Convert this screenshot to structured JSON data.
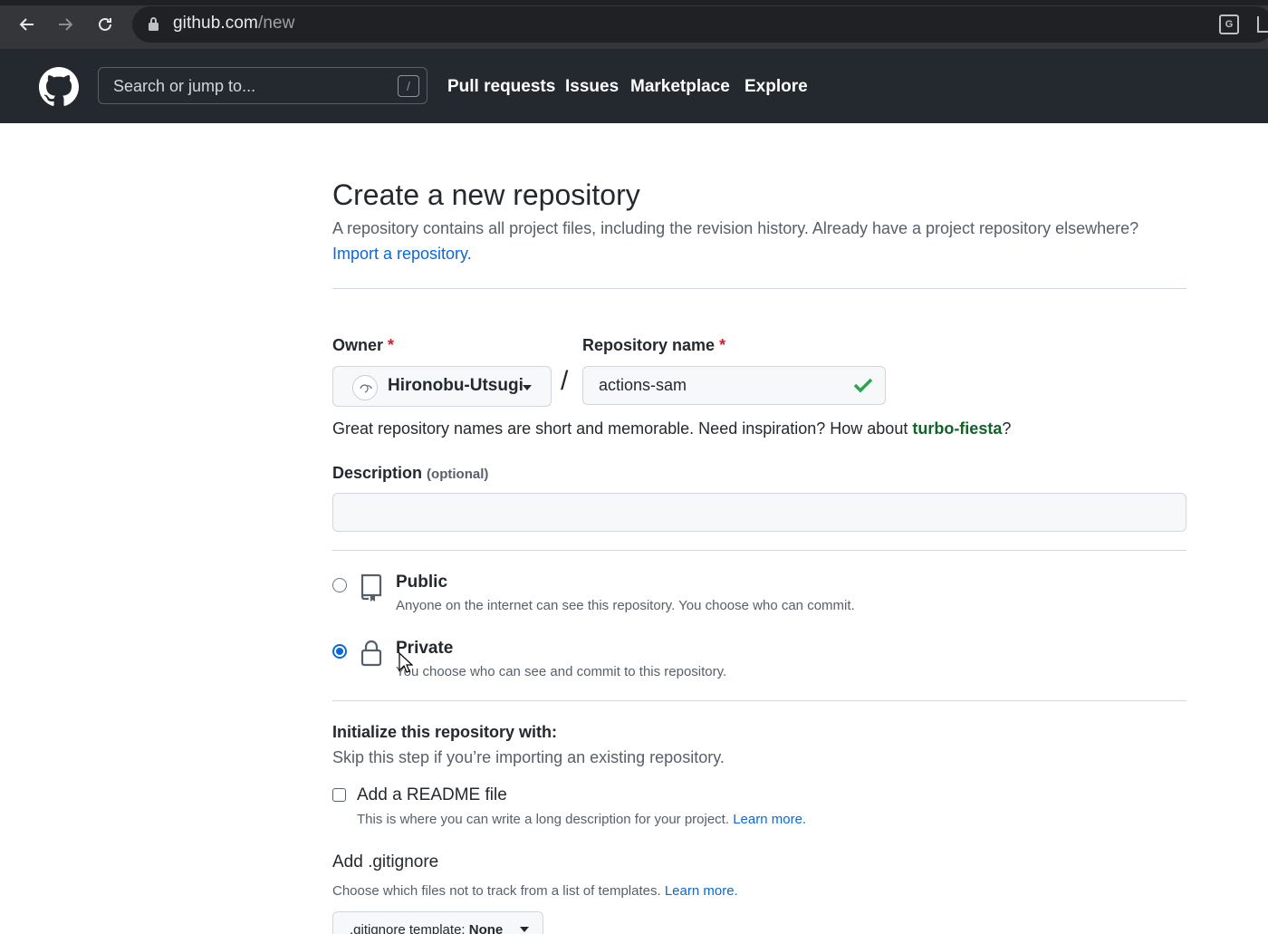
{
  "browser": {
    "url_host": "github.com",
    "url_path": "/new",
    "icons": [
      "back-arrow-icon",
      "forward-arrow-icon",
      "reload-icon",
      "lock-icon",
      "translate-icon",
      "share-icon"
    ]
  },
  "header": {
    "search_placeholder": "Search or jump to...",
    "search_shortcut": "/",
    "nav": [
      "Pull requests",
      "Issues",
      "Marketplace",
      "Explore"
    ]
  },
  "page": {
    "title": "Create a new repository",
    "subtitle": "A repository contains all project files, including the revision history. Already have a project repository elsewhere?",
    "import_link": "Import a repository."
  },
  "form": {
    "owner_label": "Owner",
    "owner_value": "Hironobu-Utsugi",
    "separator": "/",
    "repo_label": "Repository name",
    "repo_value": "actions-sam",
    "required_mark": "*",
    "hint_prefix": "Great repository names are short and memorable. Need inspiration? How about ",
    "hint_suggestion": "turbo-fiesta",
    "hint_suffix": "?",
    "description_label": "Description",
    "description_optional": "(optional)",
    "description_value": ""
  },
  "visibility": {
    "selected": "private",
    "public_title": "Public",
    "public_desc": "Anyone on the internet can see this repository. You choose who can commit.",
    "private_title": "Private",
    "private_desc": "You choose who can see and commit to this repository."
  },
  "init": {
    "title": "Initialize this repository with:",
    "desc": "Skip this step if you’re importing an existing repository.",
    "readme_label": "Add a README file",
    "readme_desc": "This is where you can write a long description for your project.",
    "learn_more": "Learn more.",
    "gitignore_title": "Add .gitignore",
    "gitignore_desc": "Choose which files not to track from a list of templates.",
    "gitignore_button_prefix": ".gitignore template:",
    "gitignore_button_value": "None"
  },
  "colors": {
    "link": "#0969da",
    "success": "#2da44e",
    "header_bg": "#24292f",
    "required": "#cf222e"
  }
}
